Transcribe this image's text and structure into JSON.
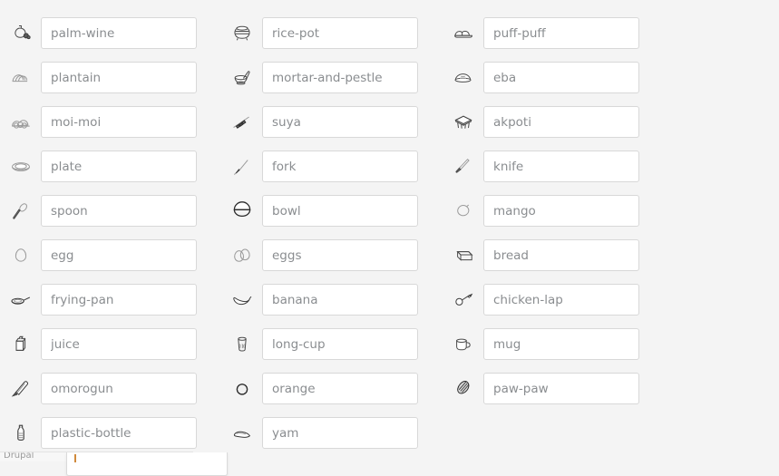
{
  "page": {
    "background_color": "#f4f4f4",
    "input_text_color": "#8a8d90",
    "input_border_color": "#d8d8d8",
    "caret_color": "#d08a3c",
    "title": "Nigerian Food & Utensil Label Grid",
    "layout": "3 columns x 10 rows of icon + text-input pairs"
  },
  "columns": 3,
  "rows": 10,
  "items": [
    {
      "icon": "calabash-gourd-icon",
      "value": "palm-wine",
      "placeholder": "palm-wine",
      "col": 1,
      "row": 1
    },
    {
      "icon": "rice-pot-icon",
      "value": "rice-pot",
      "placeholder": "rice-pot",
      "col": 2,
      "row": 1
    },
    {
      "icon": "puff-puff-icon",
      "value": "puff-puff",
      "placeholder": "puff-puff",
      "col": 3,
      "row": 1
    },
    {
      "icon": "plantain-icon",
      "value": "plantain",
      "placeholder": "plantain",
      "col": 1,
      "row": 2
    },
    {
      "icon": "mortar-and-pestle-icon",
      "value": "mortar-and-pestle",
      "placeholder": "mortar-and-pestle",
      "col": 2,
      "row": 2
    },
    {
      "icon": "eba-mound-icon",
      "value": "eba",
      "placeholder": "eba",
      "col": 3,
      "row": 2
    },
    {
      "icon": "moi-moi-icon",
      "value": "moi-moi",
      "placeholder": "moi-moi",
      "col": 1,
      "row": 3
    },
    {
      "icon": "suya-skewer-icon",
      "value": "suya",
      "placeholder": "suya",
      "col": 2,
      "row": 3
    },
    {
      "icon": "akpoti-stool-icon",
      "value": "akpoti",
      "placeholder": "akpoti",
      "col": 3,
      "row": 3
    },
    {
      "icon": "plate-icon",
      "value": "plate",
      "placeholder": "plate",
      "col": 1,
      "row": 4
    },
    {
      "icon": "fork-icon",
      "value": "fork",
      "placeholder": "fork",
      "col": 2,
      "row": 4
    },
    {
      "icon": "knife-icon",
      "value": "knife",
      "placeholder": "knife",
      "col": 3,
      "row": 4
    },
    {
      "icon": "spoon-icon",
      "value": "spoon",
      "placeholder": "spoon",
      "col": 1,
      "row": 5
    },
    {
      "icon": "bowl-icon",
      "value": "bowl",
      "placeholder": "bowl",
      "col": 2,
      "row": 5
    },
    {
      "icon": "mango-icon",
      "value": "mango",
      "placeholder": "mango",
      "col": 3,
      "row": 5
    },
    {
      "icon": "egg-icon",
      "value": "egg",
      "placeholder": "egg",
      "col": 1,
      "row": 6
    },
    {
      "icon": "eggs-icon",
      "value": "eggs",
      "placeholder": "eggs",
      "col": 2,
      "row": 6
    },
    {
      "icon": "bread-loaf-icon",
      "value": "bread",
      "placeholder": "bread",
      "col": 3,
      "row": 6
    },
    {
      "icon": "frying-pan-icon",
      "value": "frying-pan",
      "placeholder": "frying-pan",
      "col": 1,
      "row": 7
    },
    {
      "icon": "banana-icon",
      "value": "banana",
      "placeholder": "banana",
      "col": 2,
      "row": 7
    },
    {
      "icon": "chicken-lap-icon",
      "value": "chicken-lap",
      "placeholder": "chicken-lap",
      "col": 3,
      "row": 7
    },
    {
      "icon": "juice-carton-icon",
      "value": "juice",
      "placeholder": "juice",
      "col": 1,
      "row": 8
    },
    {
      "icon": "long-cup-icon",
      "value": "long-cup",
      "placeholder": "long-cup",
      "col": 2,
      "row": 8
    },
    {
      "icon": "mug-icon",
      "value": "mug",
      "placeholder": "mug",
      "col": 3,
      "row": 8
    },
    {
      "icon": "omorogun-spatula-icon",
      "value": "omorogun",
      "placeholder": "omorogun",
      "col": 1,
      "row": 9
    },
    {
      "icon": "orange-icon",
      "value": "orange",
      "placeholder": "orange",
      "col": 2,
      "row": 9
    },
    {
      "icon": "paw-paw-icon",
      "value": "paw-paw",
      "placeholder": "paw-paw",
      "col": 3,
      "row": 9
    },
    {
      "icon": "plastic-bottle-icon",
      "value": "plastic-bottle",
      "placeholder": "plastic-bottle",
      "col": 1,
      "row": 10
    },
    {
      "icon": "yam-tuber-icon",
      "value": "yam",
      "placeholder": "yam",
      "col": 2,
      "row": 10
    }
  ],
  "autocomplete": {
    "attached_to": "plastic-bottle",
    "visible": true,
    "items": []
  },
  "clipped_status_bar": {
    "text": "Drupal"
  }
}
